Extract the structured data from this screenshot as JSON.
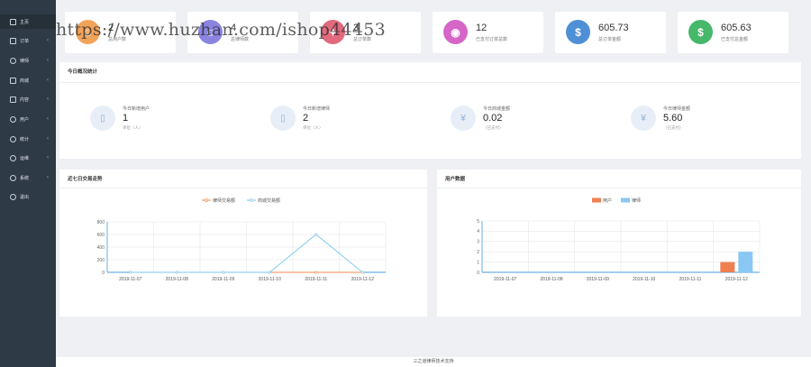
{
  "sidebar": {
    "items": [
      {
        "label": "主页",
        "icon": "copy-icon"
      },
      {
        "label": "订单",
        "icon": "list-icon"
      },
      {
        "label": "律师",
        "icon": "user-circle-icon"
      },
      {
        "label": "商城",
        "icon": "wrench-icon"
      },
      {
        "label": "内容",
        "icon": "edit-icon"
      },
      {
        "label": "用户",
        "icon": "user-icon"
      },
      {
        "label": "统计",
        "icon": "pie-icon"
      },
      {
        "label": "运维",
        "icon": "globe-icon"
      },
      {
        "label": "系统",
        "icon": "gear-icon"
      },
      {
        "label": "退出",
        "icon": "refresh-icon"
      }
    ]
  },
  "cards": [
    {
      "value": "2",
      "label": "总用户数",
      "color": "#f2a35a",
      "icon": "user-icon"
    },
    {
      "value": "4",
      "label": "总律师数",
      "color": "#8a84e0",
      "icon": "user-icon"
    },
    {
      "value": "3",
      "label": "总订单数",
      "color": "#e26a7d",
      "icon": "cart-icon"
    },
    {
      "value": "12",
      "label": "已支付订单总数",
      "color": "#d566c8",
      "icon": "chart-icon"
    },
    {
      "value": "605.73",
      "label": "总订单金额",
      "color": "#4f8fd6",
      "icon": "money-bag-icon"
    },
    {
      "value": "605.63",
      "label": "已支付总金额",
      "color": "#46b86a",
      "icon": "wallet-icon"
    }
  ],
  "today": {
    "title": "今日概况统计",
    "items": [
      {
        "title": "今日新增用户",
        "value": "1",
        "unit": "单位（人）",
        "icon": "user-plus-icon"
      },
      {
        "title": "今日新增律师",
        "value": "2",
        "unit": "单位（人）",
        "icon": "user-plus-icon"
      },
      {
        "title": "今日商城金额",
        "value": "0.02",
        "unit": "（已支付）",
        "icon": "yen-icon"
      },
      {
        "title": "今日律师金额",
        "value": "5.60",
        "unit": "（已支付）",
        "icon": "yen-icon"
      }
    ]
  },
  "watermark": "https://www.huzhan.com/ishop44453",
  "footer": "三之道律师技术支持",
  "chart_data": [
    {
      "type": "line",
      "title": "近七日交易走势",
      "categories": [
        "2019-11-07",
        "2019-11-08",
        "2019-11-09",
        "2019-11-10",
        "2019-11-11",
        "2019-11-12"
      ],
      "series": [
        {
          "name": "律师交易额",
          "color": "#f08a4b",
          "values": [
            0,
            0,
            0,
            0,
            0,
            0
          ]
        },
        {
          "name": "商城交易额",
          "color": "#7cc7f0",
          "values": [
            0,
            0,
            0,
            0,
            600,
            0
          ]
        }
      ],
      "ylim": [
        0,
        800
      ],
      "yticks": [
        0,
        200,
        400,
        600,
        800
      ],
      "grid": true,
      "legend": "top-center"
    },
    {
      "type": "bar",
      "title": "用户数据",
      "categories": [
        "2019-11-07",
        "2019-11-08",
        "2019-11-09",
        "2019-11-10",
        "2019-11-11",
        "2019-11-12"
      ],
      "series": [
        {
          "name": "用户",
          "color": "#ef7f4f",
          "values": [
            0,
            0,
            0,
            0,
            0,
            1
          ]
        },
        {
          "name": "律师",
          "color": "#88c8f2",
          "values": [
            0,
            0,
            0,
            0,
            0,
            2
          ]
        }
      ],
      "ylim": [
        0,
        5
      ],
      "yticks": [
        0,
        1,
        2,
        3,
        4,
        5
      ],
      "grid": true,
      "legend": "top-center"
    }
  ]
}
